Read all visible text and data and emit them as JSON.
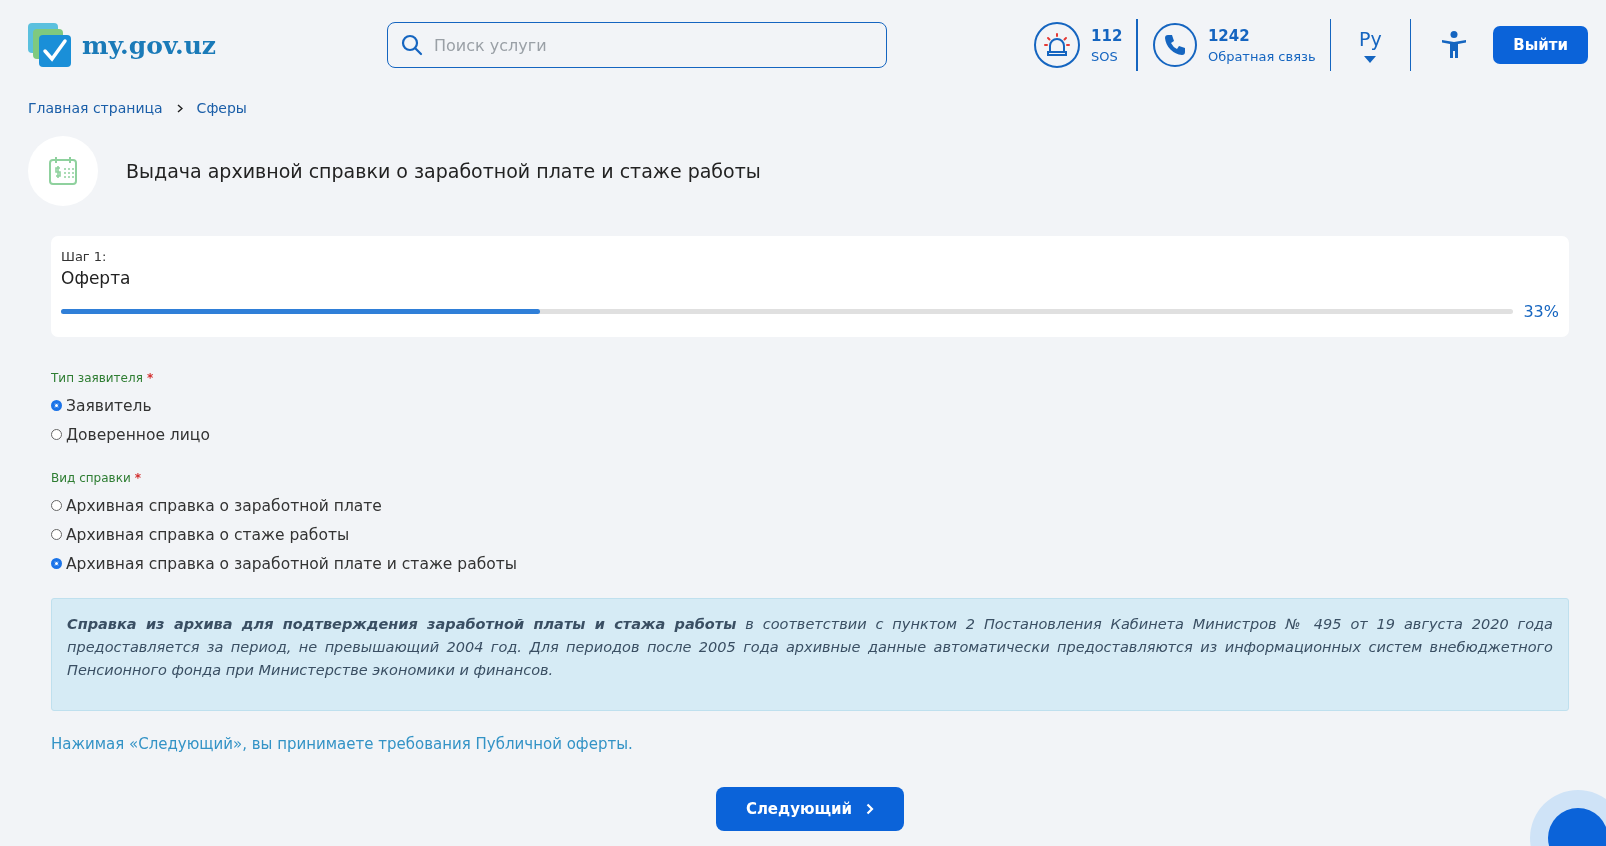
{
  "header": {
    "logo_text": "my.gov.uz",
    "search": {
      "placeholder": "Поиск услуги"
    },
    "contacts": [
      {
        "kind": "sos",
        "number": "112",
        "label": "SOS"
      },
      {
        "kind": "phone",
        "number": "1242",
        "label": "Обратная связь"
      }
    ],
    "language": "Ру",
    "logout_button": "Выйти"
  },
  "breadcrumbs": [
    {
      "label": "Главная страница"
    },
    {
      "label": "Сферы"
    }
  ],
  "service_title": "Выдача архивной справки о заработной плате и стаже работы",
  "step": {
    "label": "Шаг 1:",
    "name": "Оферта",
    "level": 0.33,
    "percent": "33%"
  },
  "fields": [
    {
      "label": "Тип заявителя",
      "required_mark": "*",
      "options": [
        {
          "label": "Заявитель",
          "selected": true
        },
        {
          "label": "Доверенное лицо",
          "selected": false
        }
      ]
    },
    {
      "label": "Вид справки",
      "required_mark": "*",
      "options": [
        {
          "label": "Архивная справка о заработной плате",
          "selected": false
        },
        {
          "label": "Архивная справка о стаже работы",
          "selected": false
        },
        {
          "label": "Архивная справка о заработной плате и стаже работы",
          "selected": true
        }
      ]
    }
  ],
  "info": "**Справка из архива для подтверждения заработной платы и стажа работы**  в соответствии с пунктом 2 Постановления Кабинета Министров № 495 от 19 августа 2020 года предоставляется за период, не превышающий 2004 год. Для периодов после 2005 года архивные данные автоматически предоставляются из информационных систем внебюджетного Пенсионного фонда при Министерстве экономики и финансов.",
  "offer_note": "Нажимая «Следующий», вы принимаете требования Публичной оферты.",
  "next_button": "Следующий"
}
